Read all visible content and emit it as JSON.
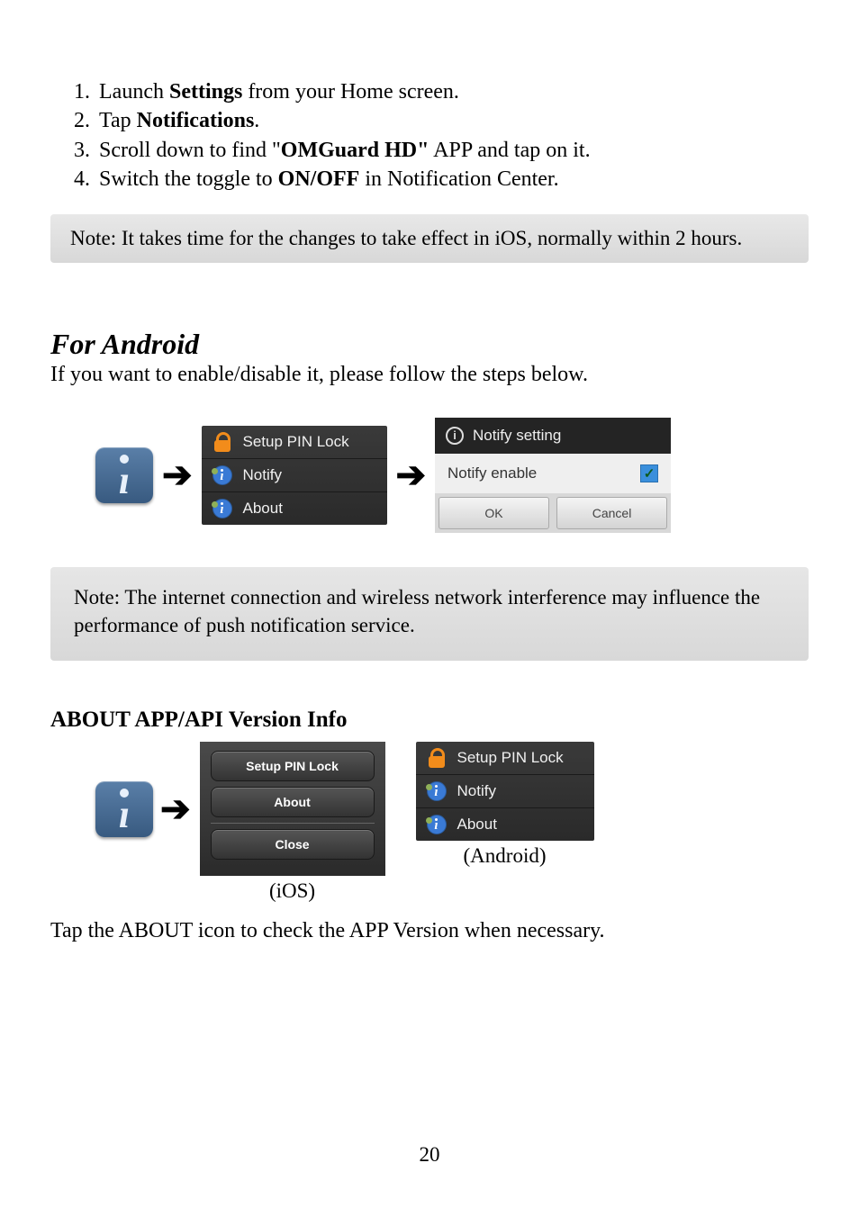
{
  "steps": {
    "s1_pre": "Launch ",
    "s1_b": "Settings",
    "s1_post": " from your Home screen.",
    "s2_pre": "Tap ",
    "s2_b": "Notifications",
    "s2_post": ".",
    "s3_pre": "Scroll down to find \"",
    "s3_b": "OMGuard HD\"",
    "s3_post": " APP and tap on it.",
    "s4_pre": "Switch the toggle to ",
    "s4_b": "ON/OFF",
    "s4_post": " in Notification Center."
  },
  "note1": "Note: It takes time for the changes to take effect in iOS, normally within 2 hours.",
  "android_heading": "For  Android",
  "android_sub": "If you want to enable/disable it, please follow the steps below.",
  "android_menu": {
    "setup_pin": "Setup PIN Lock",
    "notify": "Notify",
    "about": "About"
  },
  "notify_dialog": {
    "title": "Notify setting",
    "enable_label": "Notify enable",
    "ok": "OK",
    "cancel": "Cancel",
    "check": "✓"
  },
  "note2": "Note: The internet connection and wireless network interference may influence the performance of push notification service.",
  "about_heading": "ABOUT APP/API Version Info",
  "ios_menu": {
    "setup_pin": "Setup PIN Lock",
    "about": "About",
    "close": "Close"
  },
  "labels": {
    "ios": "(iOS)",
    "android": "(Android)"
  },
  "final_text": "Tap the ABOUT icon to check the APP Version when necessary.",
  "page_number": "20",
  "glyphs": {
    "info_i": "ı",
    "arrow": "➔"
  }
}
